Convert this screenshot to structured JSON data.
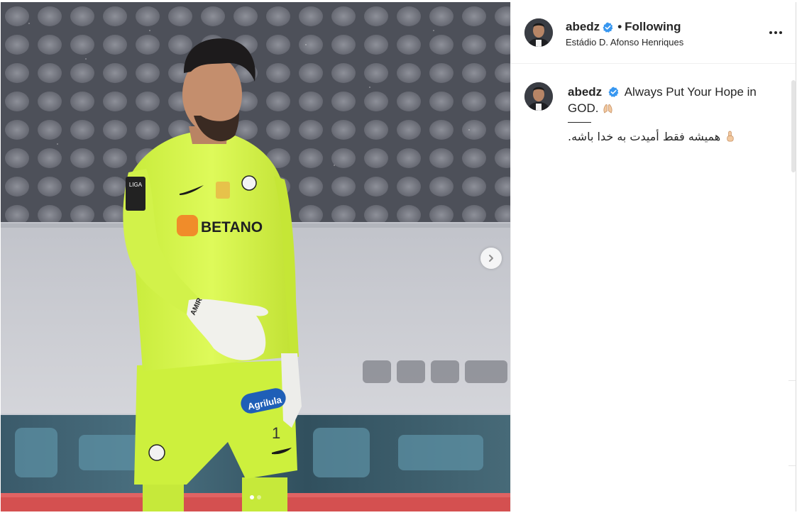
{
  "post": {
    "author": {
      "username": "abedz",
      "location": "Estádio D. Afonso Henriques",
      "follow_status": "Following",
      "separator": "•"
    },
    "caption": {
      "username": "abedz",
      "text_en": "Always Put Your Hope in GOD.",
      "text_fa": ".همیشه فقط أمیدت به خدا باشه"
    },
    "media": {
      "sponsor_text": "BETANO",
      "shorts_sponsor": "Agrilula",
      "shirt_number": "1",
      "glove_text": "AMIR",
      "sleeve_badge": "LIGA",
      "carousel": {
        "current": 1,
        "total": 2
      }
    }
  },
  "icons": {
    "verified": "verified-badge-icon",
    "more": "more-options-icon",
    "next": "chevron-right-icon",
    "pray": "folded-hands-emoji",
    "pointing": "pointing-up-emoji"
  },
  "colors": {
    "verified_blue": "#3897f0",
    "text": "#262626",
    "jersey": "#d7f74a"
  }
}
